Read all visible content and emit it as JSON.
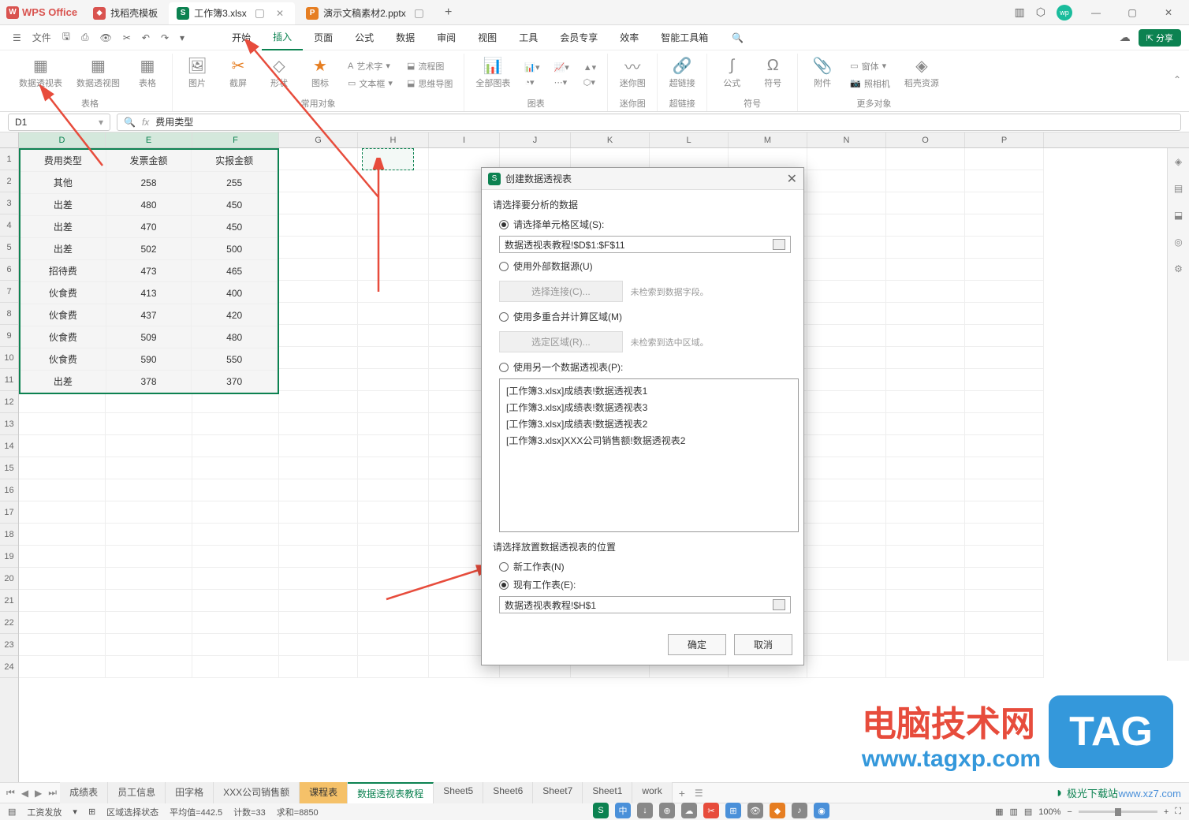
{
  "app": {
    "name": "WPS Office"
  },
  "tabs": [
    {
      "icon": "red",
      "iconText": "⬥",
      "label": "找稻壳模板"
    },
    {
      "icon": "green",
      "iconText": "S",
      "label": "工作簿3.xlsx",
      "active": true
    },
    {
      "icon": "orange",
      "iconText": "P",
      "label": "演示文稿素材2.pptx"
    }
  ],
  "menu": {
    "file": "文件",
    "items": [
      "开始",
      "插入",
      "页面",
      "公式",
      "数据",
      "审阅",
      "视图",
      "工具",
      "会员专享",
      "效率",
      "智能工具箱"
    ],
    "active_index": 1,
    "share": "⇱ 分享"
  },
  "ribbon": {
    "g1": {
      "label": "表格",
      "btns": [
        "数据透视表",
        "数据透视图",
        "表格"
      ]
    },
    "g2": {
      "label": "常用对象",
      "btns": [
        "图片",
        "截屏",
        "形状",
        "图标"
      ],
      "small": [
        "艺术字",
        "流程图",
        "文本框",
        "思维导图"
      ]
    },
    "g3": {
      "label": "图表",
      "btn": "全部图表"
    },
    "g4": {
      "label": "迷你图",
      "btn": "迷你图"
    },
    "g5": {
      "label": "超链接",
      "btn": "超链接"
    },
    "g6": {
      "label": "符号",
      "btns": [
        "公式",
        "符号"
      ]
    },
    "g7": {
      "label": "更多对象",
      "btn": "附件",
      "small": [
        "窗体",
        "照相机",
        "稻壳资源"
      ]
    }
  },
  "refbar": {
    "cell": "D1",
    "formula": "费用类型"
  },
  "columns": [
    "D",
    "E",
    "F",
    "G",
    "H",
    "I",
    "J",
    "K",
    "L",
    "M",
    "N",
    "O",
    "P"
  ],
  "col_sel": [
    "D",
    "E",
    "F"
  ],
  "table": {
    "headers": [
      "费用类型",
      "发票金额",
      "实报金额"
    ],
    "rows": [
      [
        "其他",
        "258",
        "255"
      ],
      [
        "出差",
        "480",
        "450"
      ],
      [
        "出差",
        "470",
        "450"
      ],
      [
        "出差",
        "502",
        "500"
      ],
      [
        "招待费",
        "473",
        "465"
      ],
      [
        "伙食费",
        "413",
        "400"
      ],
      [
        "伙食费",
        "437",
        "420"
      ],
      [
        "伙食费",
        "509",
        "480"
      ],
      [
        "伙食费",
        "590",
        "550"
      ],
      [
        "出差",
        "378",
        "370"
      ]
    ]
  },
  "dialog": {
    "title": "创建数据透视表",
    "section1": "请选择要分析的数据",
    "opt1": "请选择单元格区域(S):",
    "input1": "数据透视表教程!$D$1:$F$11",
    "opt2": "使用外部数据源(U)",
    "btn2": "选择连接(C)...",
    "note2": "未检索到数据字段。",
    "opt3": "使用多重合并计算区域(M)",
    "btn3": "选定区域(R)...",
    "note3": "未检索到选中区域。",
    "opt4": "使用另一个数据透视表(P):",
    "list": [
      "[工作簿3.xlsx]成绩表!数据透视表1",
      "[工作簿3.xlsx]成绩表!数据透视表3",
      "[工作簿3.xlsx]成绩表!数据透视表2",
      "[工作簿3.xlsx]XXX公司销售额!数据透视表2"
    ],
    "section2": "请选择放置数据透视表的位置",
    "opt5": "新工作表(N)",
    "opt6": "现有工作表(E):",
    "input2": "数据透视表教程!$H$1",
    "ok": "确定",
    "cancel": "取消"
  },
  "sheets": [
    "成绩表",
    "员工信息",
    "田字格",
    "XXX公司销售额",
    "课程表",
    "数据透视表教程",
    "Sheet5",
    "Sheet6",
    "Sheet7",
    "Sheet1",
    "work"
  ],
  "sheet_active": 5,
  "sheet_highlight": 4,
  "status": {
    "left1": "工资发放",
    "left2": "区域选择状态",
    "avg": "平均值=442.5",
    "count": "计数=33",
    "sum": "求和=8850",
    "zoom": "100%"
  },
  "watermark": {
    "text": "电脑技术网",
    "tag": "TAG",
    "url": "www.tagxp.com",
    "url2": "www.xz7.com",
    "logo": "极光下载站"
  }
}
